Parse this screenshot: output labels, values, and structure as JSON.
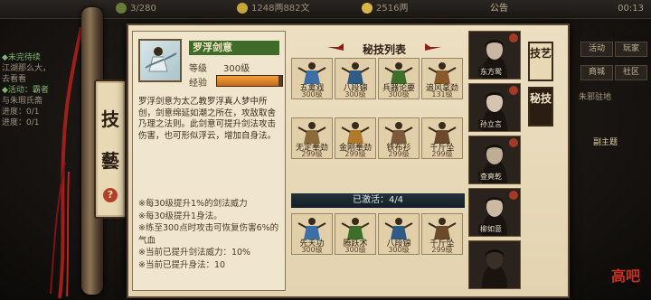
{
  "topbar": {
    "res1": "3/280",
    "res2": "1248两882文",
    "res3": "2516两",
    "announcement": "公告",
    "time": "00:13"
  },
  "quests": {
    "lines": [
      {
        "text": "◆未完待续",
        "color": "g"
      },
      {
        "text": "江湖那么大，",
        "color": "w"
      },
      {
        "text": "去看看",
        "color": "w"
      },
      {
        "text": "◆活动：霸者",
        "color": "g"
      },
      {
        "text": "与朱瑕氏斋",
        "color": "w"
      },
      {
        "text": "进度：0/1",
        "color": "w"
      },
      {
        "text": "进度：0/1",
        "color": "w"
      }
    ]
  },
  "side_tab": {
    "char1": "技",
    "char2": "藝",
    "help": "?"
  },
  "detail": {
    "name": "罗浮剑意",
    "level_label": "等级",
    "level_value": "300级",
    "exp_label": "经验",
    "exp_fraction": 0.95,
    "description": "罗浮剑意为太乙教罗浮真人梦中所创，剑意绵延如潮之所在，攻敌取舍乃理之法则。此剑意可提升剑法攻击伤害，也可形似浮云，增加自身法。",
    "bonuses": [
      "※每30级提升1%的剑法威力",
      "※每30级提升1身法。",
      "※练至300点时攻击可恢复伤害6%的气血",
      "※当前已提升剑法威力：10%",
      "※当前已提升身法：10"
    ]
  },
  "list": {
    "title": "秘技列表",
    "skills": [
      {
        "name": "五禽戏",
        "level": "300级",
        "color": "#3b6fa8"
      },
      {
        "name": "八段锦",
        "level": "300级",
        "color": "#2f5c86"
      },
      {
        "name": "兵器论要",
        "level": "300级",
        "color": "#3d6e2a"
      },
      {
        "name": "追风拿劲",
        "level": "131级",
        "color": "#8a5b2a"
      },
      {
        "name": "无定拳劲",
        "level": "299级",
        "color": "#8a6a3a"
      },
      {
        "name": "金刚拳劲",
        "level": "299级",
        "color": "#b07a2a"
      },
      {
        "name": "铁布衫",
        "level": "299级",
        "color": "#7a5a3a"
      },
      {
        "name": "千斤坠",
        "level": "299级",
        "color": "#6a4a2a"
      }
    ],
    "activated_text": "已激活：4/4",
    "active_skills": [
      {
        "name": "先天功",
        "level": "300级",
        "color": "#3b6fa8"
      },
      {
        "name": "腾跃术",
        "level": "300级",
        "color": "#3d6e2a"
      },
      {
        "name": "八段锦",
        "level": "300级",
        "color": "#2f5c86"
      },
      {
        "name": "千斤坠",
        "level": "299级",
        "color": "#6a4a2a"
      }
    ]
  },
  "characters": [
    {
      "name": "东方鸳"
    },
    {
      "name": "孙立言"
    },
    {
      "name": "查爽乾"
    },
    {
      "name": "柳如意"
    },
    {
      "name": ""
    }
  ],
  "right_tabs": [
    {
      "label": "技艺",
      "active": false
    },
    {
      "label": "秘技",
      "active": true
    }
  ],
  "right_menu": {
    "buttons": [
      "活动",
      "玩家",
      "商城",
      "社区"
    ],
    "line1": "朱邪驻地",
    "line2": "副主题"
  },
  "logo_text": "高吧"
}
